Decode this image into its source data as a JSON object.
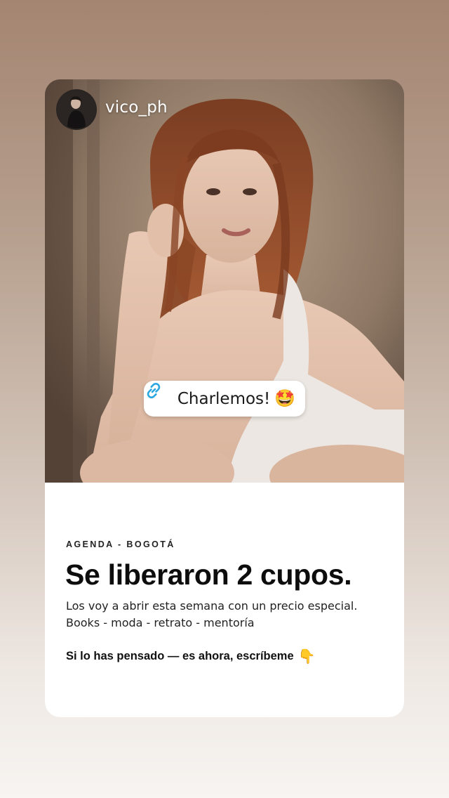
{
  "story": {
    "username": "vico_ph",
    "avatar_icon": "profile-photo",
    "link_sticker": {
      "icon": "link-icon",
      "label": "Charlemos!",
      "emoji": "🤩"
    }
  },
  "info": {
    "eyebrow": "AGENDA - BOGOTÁ",
    "headline": "Se liberaron 2 cupos.",
    "body_line_1": "Los voy a abrir esta semana con un precio especial.",
    "body_line_2": "Books - moda - retrato - mentoría",
    "cta": "Si lo has pensado — es ahora, escríbeme",
    "cta_emoji": "👇"
  },
  "colors": {
    "link_icon": "#2aa6e0",
    "background_top": "#a48571",
    "background_bottom": "#f7f4f1",
    "card": "#ffffff"
  }
}
